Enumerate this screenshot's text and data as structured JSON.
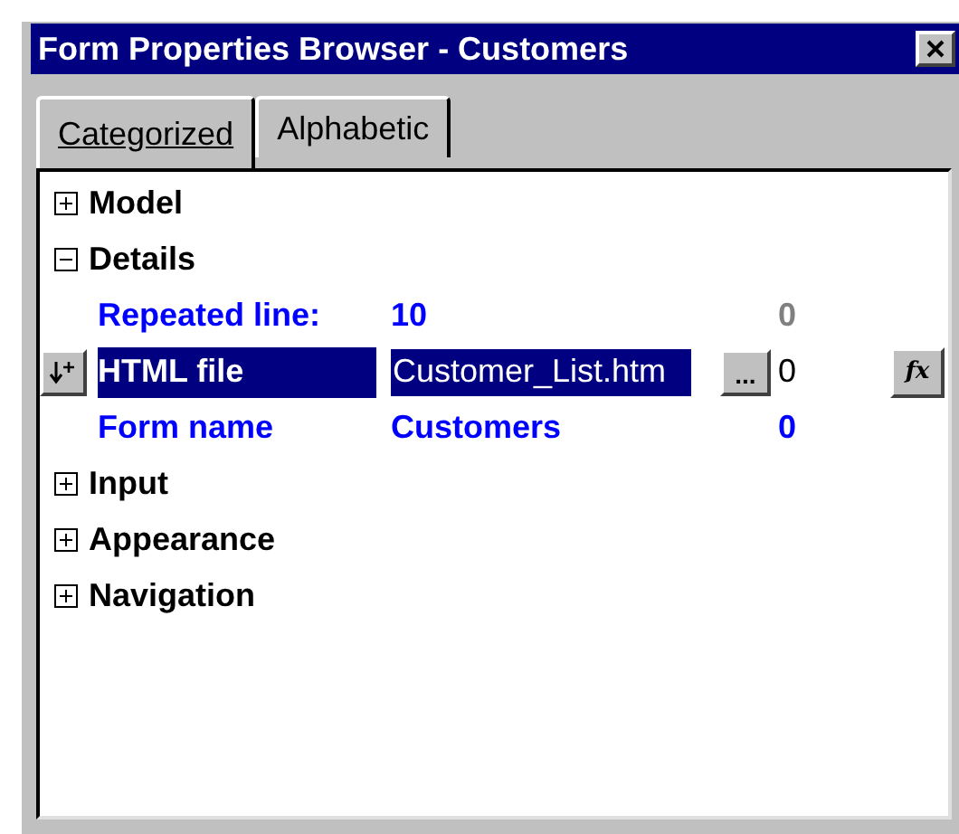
{
  "window": {
    "title": "Form Properties Browser - Customers"
  },
  "tabs": [
    {
      "label": "Categorized",
      "selected": true
    },
    {
      "label": "Alphabetic",
      "selected": false
    }
  ],
  "tree": [
    {
      "label": "Model",
      "expanded": false
    },
    {
      "label": "Details",
      "expanded": true,
      "children": [
        {
          "label": "Repeated line:",
          "value": "10",
          "count": "0",
          "selected": false,
          "modified": true,
          "count_dimmed": true
        },
        {
          "label": "HTML file",
          "value": "Customer_List.htm",
          "count": "0",
          "selected": true,
          "modified": false,
          "count_dimmed": false,
          "browse_button": "...",
          "formula_button": "fx"
        },
        {
          "label": "Form name",
          "value": "Customers",
          "count": "0",
          "selected": false,
          "modified": true,
          "count_dimmed": false
        }
      ]
    },
    {
      "label": "Input",
      "expanded": false
    },
    {
      "label": "Appearance",
      "expanded": false
    },
    {
      "label": "Navigation",
      "expanded": false
    }
  ]
}
